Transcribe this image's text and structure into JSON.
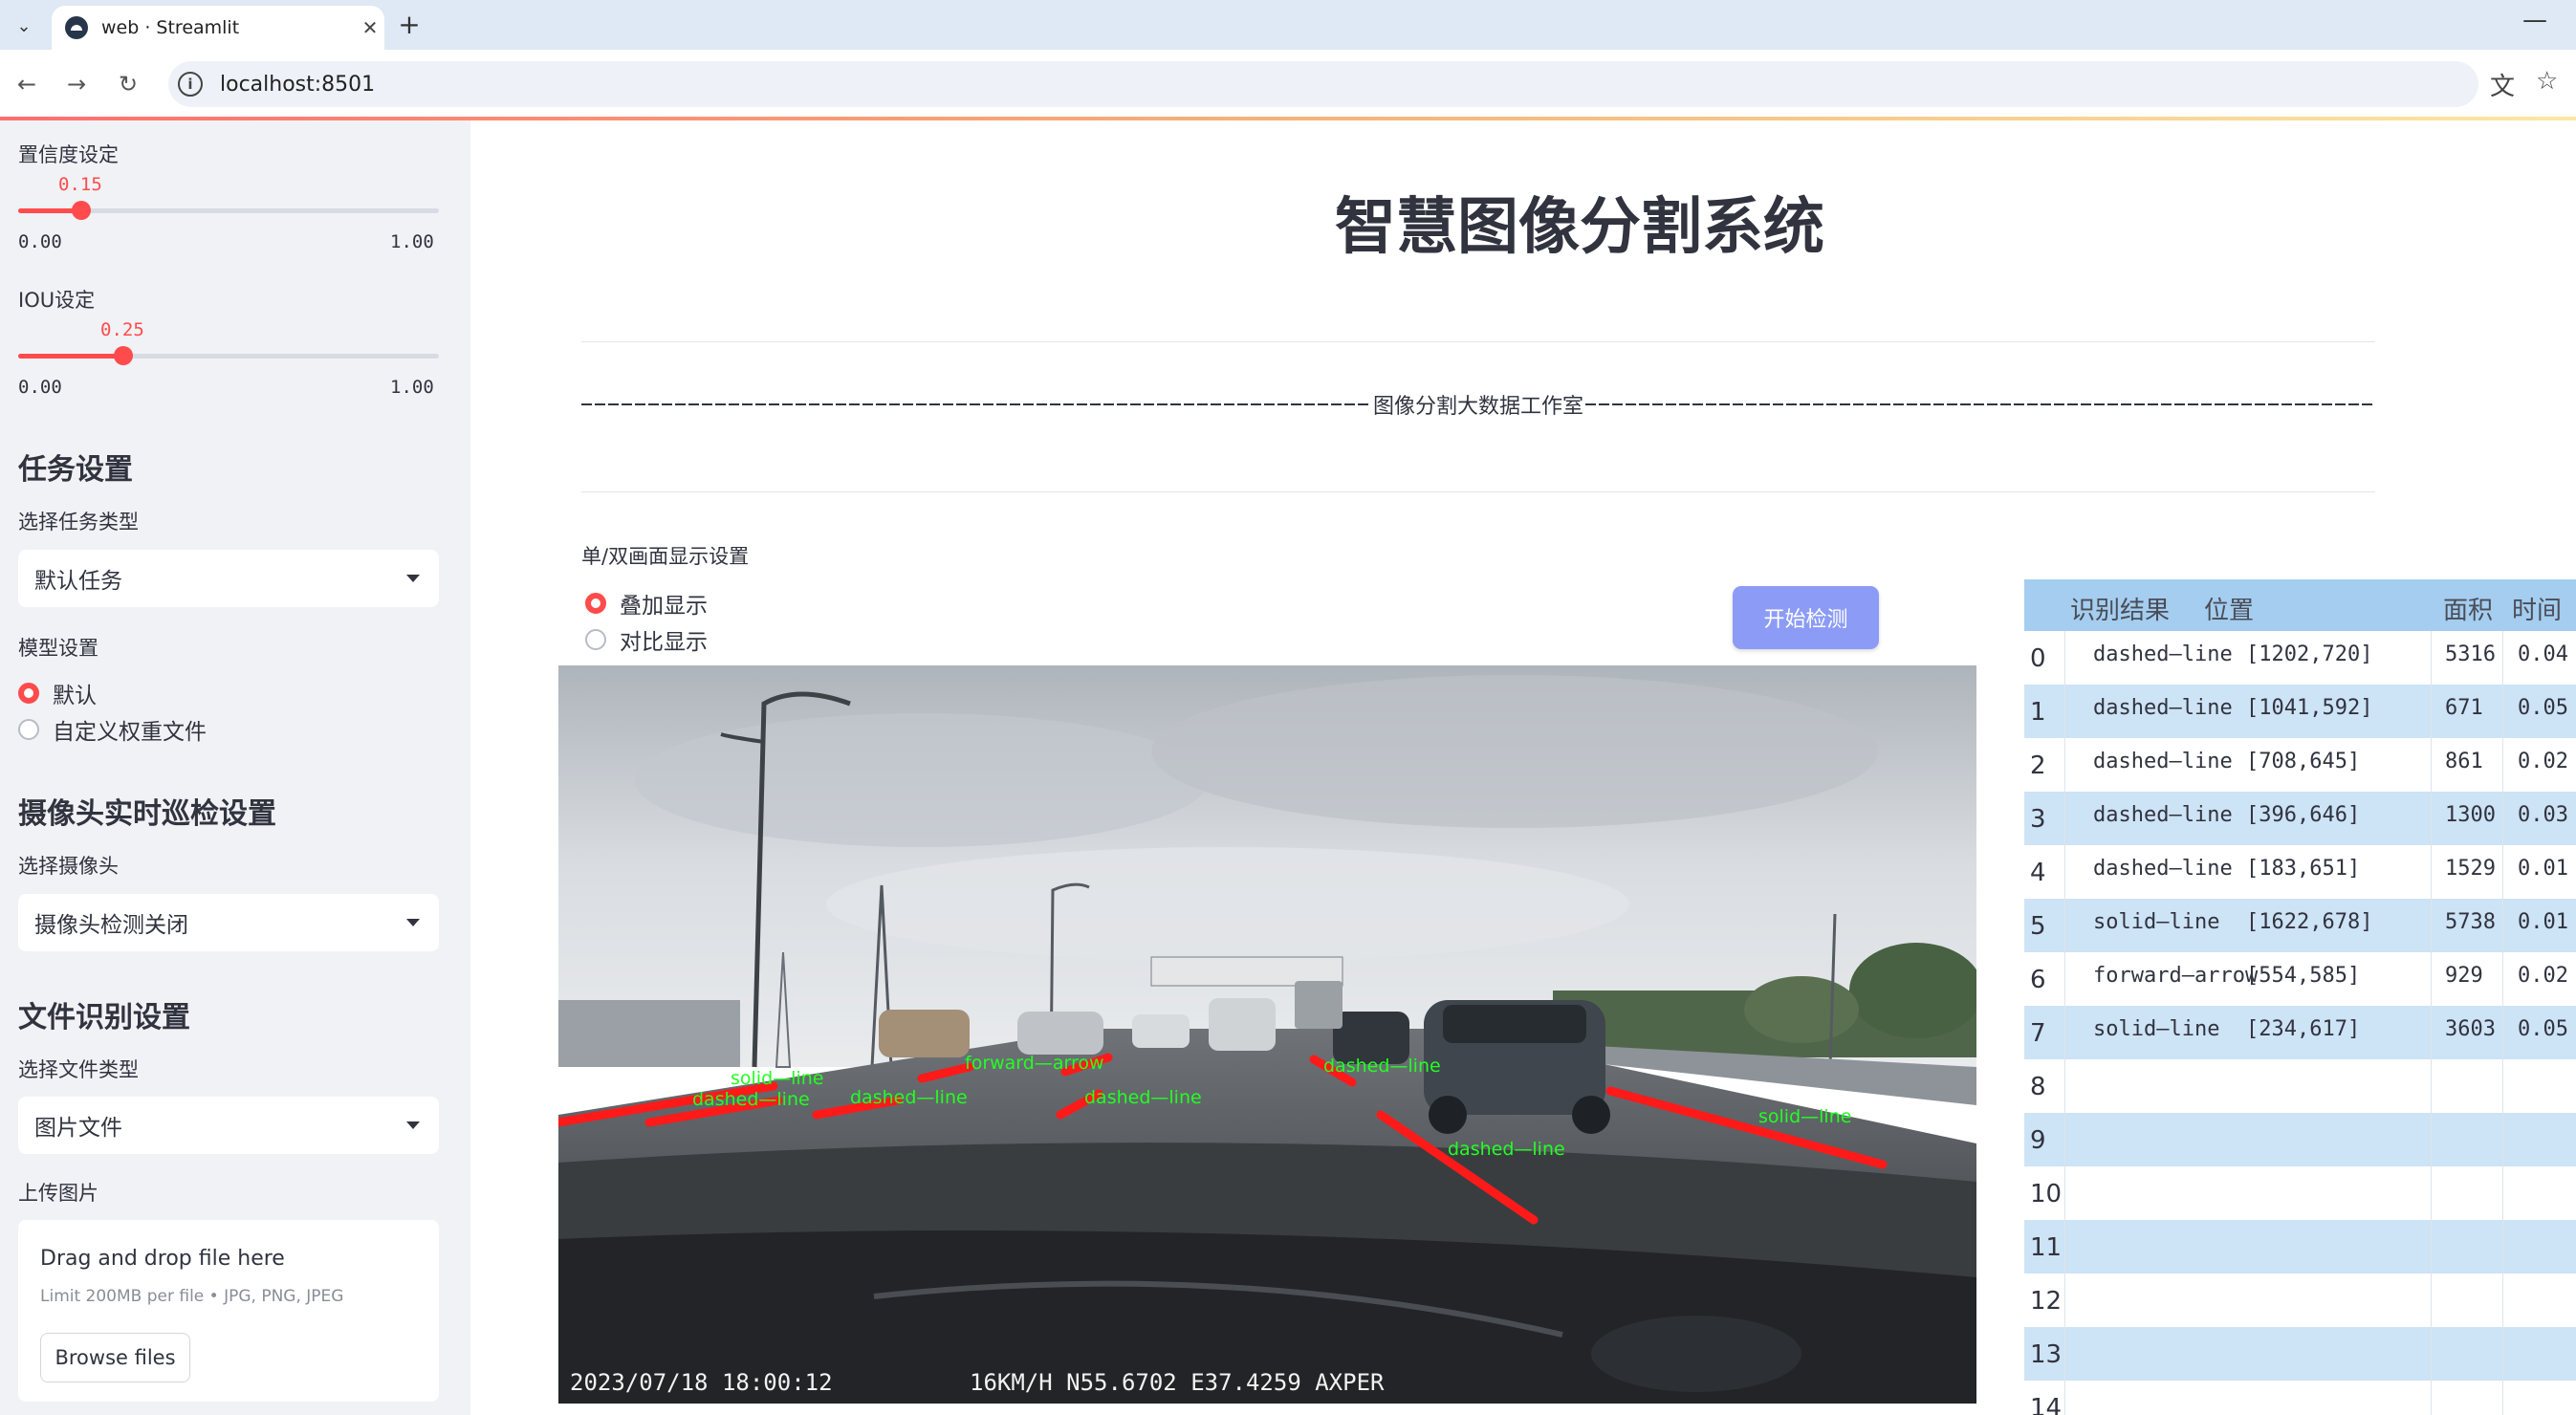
{
  "browser": {
    "tab_title": "web · Streamlit",
    "url": "localhost:8501",
    "icons": [
      "chevron-down-icon",
      "close-icon",
      "plus-icon",
      "minimize-icon",
      "back-icon",
      "forward-icon",
      "reload-icon",
      "info-icon",
      "translate-icon",
      "star-icon"
    ]
  },
  "sidebar": {
    "confidence": {
      "label": "置信度设定",
      "value": "0.15",
      "fraction": 0.15,
      "min": "0.00",
      "max": "1.00"
    },
    "iou": {
      "label": "IOU设定",
      "value": "0.25",
      "fraction": 0.25,
      "min": "0.00",
      "max": "1.00"
    },
    "task_header": "任务设置",
    "task_type_label": "选择任务类型",
    "task_type_value": "默认任务",
    "model_label": "模型设置",
    "model_options": [
      "默认",
      "自定义权重文件"
    ],
    "model_selected": 0,
    "camera_header": "摄像头实时巡检设置",
    "camera_label": "选择摄像头",
    "camera_value": "摄像头检测关闭",
    "file_header": "文件识别设置",
    "file_type_label": "选择文件类型",
    "file_type_value": "图片文件",
    "upload_label": "上传图片",
    "upload_title": "Drag and drop file here",
    "upload_limit": "Limit 200MB per file • JPG, PNG, JPEG",
    "browse_label": "Browse files"
  },
  "main": {
    "title": "智慧图像分割系统",
    "studio": "图像分割大数据工作室",
    "display_mode_label": "单/双画面显示设置",
    "display_options": [
      "叠加显示",
      "对比显示"
    ],
    "display_selected": 0,
    "detect_button": "开始检测"
  },
  "image": {
    "timestamp": "2023/07/18 18:00:12",
    "telemetry": "16KM/H N55.6702 E37.4259 AXPER",
    "detection_labels": [
      "solid—line",
      "dashed—line",
      "dashed—line",
      "forward—arrow",
      "dashed—line",
      "dashed—line",
      "dashed—line",
      "solid—line"
    ],
    "mask_color": "#ff1a1a",
    "label_color": "#22ff22"
  },
  "table": {
    "headers": [
      "识别结果",
      "位置",
      "面积",
      "时间"
    ],
    "rows": [
      {
        "idx": "0",
        "cls": "dashed—line",
        "pos": "[1202,720]",
        "area": "5316",
        "time": "0.04"
      },
      {
        "idx": "1",
        "cls": "dashed—line",
        "pos": "[1041,592]",
        "area": "671",
        "time": "0.05"
      },
      {
        "idx": "2",
        "cls": "dashed—line",
        "pos": "[708,645]",
        "area": "861",
        "time": "0.02"
      },
      {
        "idx": "3",
        "cls": "dashed—line",
        "pos": "[396,646]",
        "area": "1300",
        "time": "0.03"
      },
      {
        "idx": "4",
        "cls": "dashed—line",
        "pos": "[183,651]",
        "area": "1529",
        "time": "0.01"
      },
      {
        "idx": "5",
        "cls": "solid—line",
        "pos": "[1622,678]",
        "area": "5738",
        "time": "0.01"
      },
      {
        "idx": "6",
        "cls": "forward—arrow",
        "pos": "[554,585]",
        "area": "929",
        "time": "0.02"
      },
      {
        "idx": "7",
        "cls": "solid—line",
        "pos": "[234,617]",
        "area": "3603",
        "time": "0.05"
      },
      {
        "idx": "8",
        "cls": "",
        "pos": "",
        "area": "",
        "time": ""
      },
      {
        "idx": "9",
        "cls": "",
        "pos": "",
        "area": "",
        "time": ""
      },
      {
        "idx": "10",
        "cls": "",
        "pos": "",
        "area": "",
        "time": ""
      },
      {
        "idx": "11",
        "cls": "",
        "pos": "",
        "area": "",
        "time": ""
      },
      {
        "idx": "12",
        "cls": "",
        "pos": "",
        "area": "",
        "time": ""
      },
      {
        "idx": "13",
        "cls": "",
        "pos": "",
        "area": "",
        "time": ""
      },
      {
        "idx": "14",
        "cls": "",
        "pos": "",
        "area": "",
        "time": ""
      }
    ]
  }
}
